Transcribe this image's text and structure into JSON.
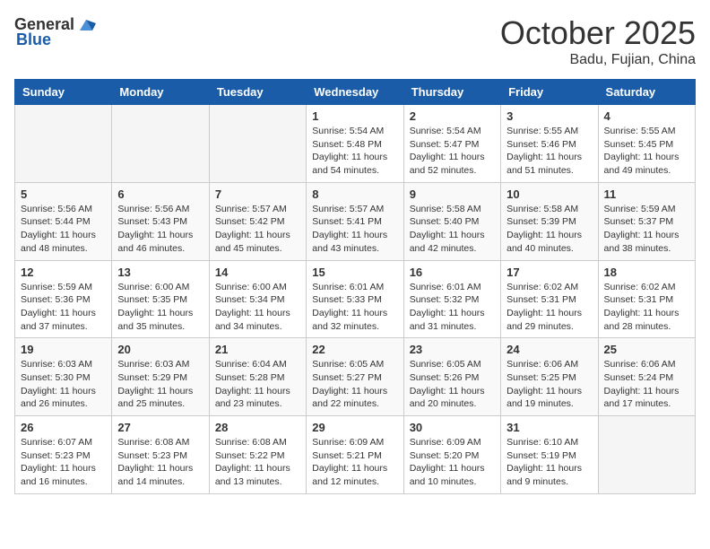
{
  "header": {
    "logo_general": "General",
    "logo_blue": "Blue",
    "month": "October 2025",
    "location": "Badu, Fujian, China"
  },
  "weekdays": [
    "Sunday",
    "Monday",
    "Tuesday",
    "Wednesday",
    "Thursday",
    "Friday",
    "Saturday"
  ],
  "weeks": [
    [
      {
        "day": "",
        "info": ""
      },
      {
        "day": "",
        "info": ""
      },
      {
        "day": "",
        "info": ""
      },
      {
        "day": "1",
        "info": "Sunrise: 5:54 AM\nSunset: 5:48 PM\nDaylight: 11 hours\nand 54 minutes."
      },
      {
        "day": "2",
        "info": "Sunrise: 5:54 AM\nSunset: 5:47 PM\nDaylight: 11 hours\nand 52 minutes."
      },
      {
        "day": "3",
        "info": "Sunrise: 5:55 AM\nSunset: 5:46 PM\nDaylight: 11 hours\nand 51 minutes."
      },
      {
        "day": "4",
        "info": "Sunrise: 5:55 AM\nSunset: 5:45 PM\nDaylight: 11 hours\nand 49 minutes."
      }
    ],
    [
      {
        "day": "5",
        "info": "Sunrise: 5:56 AM\nSunset: 5:44 PM\nDaylight: 11 hours\nand 48 minutes."
      },
      {
        "day": "6",
        "info": "Sunrise: 5:56 AM\nSunset: 5:43 PM\nDaylight: 11 hours\nand 46 minutes."
      },
      {
        "day": "7",
        "info": "Sunrise: 5:57 AM\nSunset: 5:42 PM\nDaylight: 11 hours\nand 45 minutes."
      },
      {
        "day": "8",
        "info": "Sunrise: 5:57 AM\nSunset: 5:41 PM\nDaylight: 11 hours\nand 43 minutes."
      },
      {
        "day": "9",
        "info": "Sunrise: 5:58 AM\nSunset: 5:40 PM\nDaylight: 11 hours\nand 42 minutes."
      },
      {
        "day": "10",
        "info": "Sunrise: 5:58 AM\nSunset: 5:39 PM\nDaylight: 11 hours\nand 40 minutes."
      },
      {
        "day": "11",
        "info": "Sunrise: 5:59 AM\nSunset: 5:37 PM\nDaylight: 11 hours\nand 38 minutes."
      }
    ],
    [
      {
        "day": "12",
        "info": "Sunrise: 5:59 AM\nSunset: 5:36 PM\nDaylight: 11 hours\nand 37 minutes."
      },
      {
        "day": "13",
        "info": "Sunrise: 6:00 AM\nSunset: 5:35 PM\nDaylight: 11 hours\nand 35 minutes."
      },
      {
        "day": "14",
        "info": "Sunrise: 6:00 AM\nSunset: 5:34 PM\nDaylight: 11 hours\nand 34 minutes."
      },
      {
        "day": "15",
        "info": "Sunrise: 6:01 AM\nSunset: 5:33 PM\nDaylight: 11 hours\nand 32 minutes."
      },
      {
        "day": "16",
        "info": "Sunrise: 6:01 AM\nSunset: 5:32 PM\nDaylight: 11 hours\nand 31 minutes."
      },
      {
        "day": "17",
        "info": "Sunrise: 6:02 AM\nSunset: 5:31 PM\nDaylight: 11 hours\nand 29 minutes."
      },
      {
        "day": "18",
        "info": "Sunrise: 6:02 AM\nSunset: 5:31 PM\nDaylight: 11 hours\nand 28 minutes."
      }
    ],
    [
      {
        "day": "19",
        "info": "Sunrise: 6:03 AM\nSunset: 5:30 PM\nDaylight: 11 hours\nand 26 minutes."
      },
      {
        "day": "20",
        "info": "Sunrise: 6:03 AM\nSunset: 5:29 PM\nDaylight: 11 hours\nand 25 minutes."
      },
      {
        "day": "21",
        "info": "Sunrise: 6:04 AM\nSunset: 5:28 PM\nDaylight: 11 hours\nand 23 minutes."
      },
      {
        "day": "22",
        "info": "Sunrise: 6:05 AM\nSunset: 5:27 PM\nDaylight: 11 hours\nand 22 minutes."
      },
      {
        "day": "23",
        "info": "Sunrise: 6:05 AM\nSunset: 5:26 PM\nDaylight: 11 hours\nand 20 minutes."
      },
      {
        "day": "24",
        "info": "Sunrise: 6:06 AM\nSunset: 5:25 PM\nDaylight: 11 hours\nand 19 minutes."
      },
      {
        "day": "25",
        "info": "Sunrise: 6:06 AM\nSunset: 5:24 PM\nDaylight: 11 hours\nand 17 minutes."
      }
    ],
    [
      {
        "day": "26",
        "info": "Sunrise: 6:07 AM\nSunset: 5:23 PM\nDaylight: 11 hours\nand 16 minutes."
      },
      {
        "day": "27",
        "info": "Sunrise: 6:08 AM\nSunset: 5:23 PM\nDaylight: 11 hours\nand 14 minutes."
      },
      {
        "day": "28",
        "info": "Sunrise: 6:08 AM\nSunset: 5:22 PM\nDaylight: 11 hours\nand 13 minutes."
      },
      {
        "day": "29",
        "info": "Sunrise: 6:09 AM\nSunset: 5:21 PM\nDaylight: 11 hours\nand 12 minutes."
      },
      {
        "day": "30",
        "info": "Sunrise: 6:09 AM\nSunset: 5:20 PM\nDaylight: 11 hours\nand 10 minutes."
      },
      {
        "day": "31",
        "info": "Sunrise: 6:10 AM\nSunset: 5:19 PM\nDaylight: 11 hours\nand 9 minutes."
      },
      {
        "day": "",
        "info": ""
      }
    ]
  ]
}
